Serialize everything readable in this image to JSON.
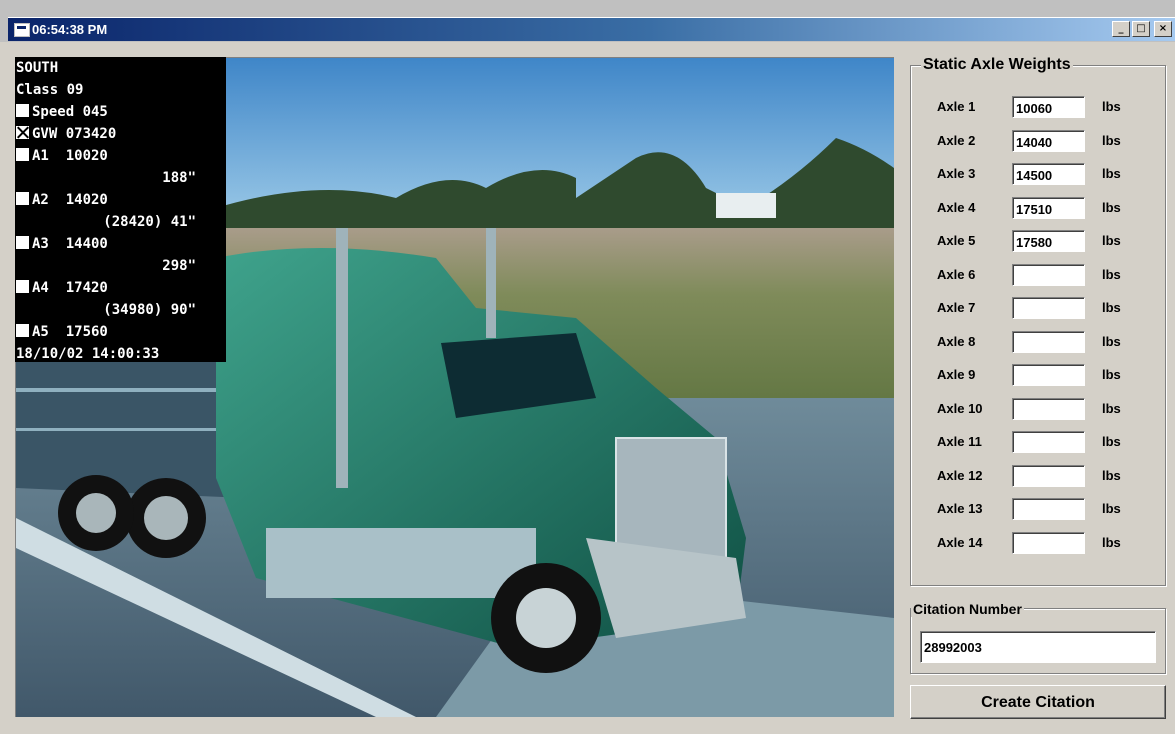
{
  "window": {
    "title": "06:54:38 PM",
    "minimize": "_",
    "maximize": "□",
    "close": "×"
  },
  "overlay": {
    "direction": "SOUTH",
    "class_line": "Class 09",
    "lines": [
      {
        "checkbox": "empty",
        "text": "Speed 045"
      },
      {
        "checkbox": "x",
        "text": "GVW 073420"
      },
      {
        "checkbox": "empty",
        "text": "A1  10020"
      },
      {
        "checkbox": "none",
        "text": "188\"",
        "align": "right"
      },
      {
        "checkbox": "empty",
        "text": "A2  14020"
      },
      {
        "checkbox": "none",
        "text": "(28420) 41\"",
        "align": "right"
      },
      {
        "checkbox": "empty",
        "text": "A3  14400"
      },
      {
        "checkbox": "none",
        "text": "298\"",
        "align": "right"
      },
      {
        "checkbox": "empty",
        "text": "A4  17420"
      },
      {
        "checkbox": "none",
        "text": "(34980) 90\"",
        "align": "right"
      },
      {
        "checkbox": "empty",
        "text": "A5  17560"
      }
    ],
    "timestamp": "18/10/02 14:00:33"
  },
  "axle_weights": {
    "title": "Static Axle Weights",
    "unit": "lbs",
    "axles": [
      {
        "label": "Axle 1",
        "value": "10060"
      },
      {
        "label": "Axle 2",
        "value": "14040"
      },
      {
        "label": "Axle 3",
        "value": "14500"
      },
      {
        "label": "Axle 4",
        "value": "17510"
      },
      {
        "label": "Axle 5",
        "value": "17580"
      },
      {
        "label": "Axle 6",
        "value": ""
      },
      {
        "label": "Axle 7",
        "value": ""
      },
      {
        "label": "Axle 8",
        "value": ""
      },
      {
        "label": "Axle 9",
        "value": ""
      },
      {
        "label": "Axle 10",
        "value": ""
      },
      {
        "label": "Axle 11",
        "value": ""
      },
      {
        "label": "Axle 12",
        "value": ""
      },
      {
        "label": "Axle 13",
        "value": ""
      },
      {
        "label": "Axle 14",
        "value": ""
      }
    ]
  },
  "citation": {
    "label": "Citation Number",
    "value": "28992003",
    "button_label": "Create Citation"
  },
  "colors": {
    "titlebar_start": "#0a246a",
    "titlebar_end": "#a6caf0",
    "window_bg": "#d4d0c8",
    "truck_green": "#1f6f5a"
  }
}
